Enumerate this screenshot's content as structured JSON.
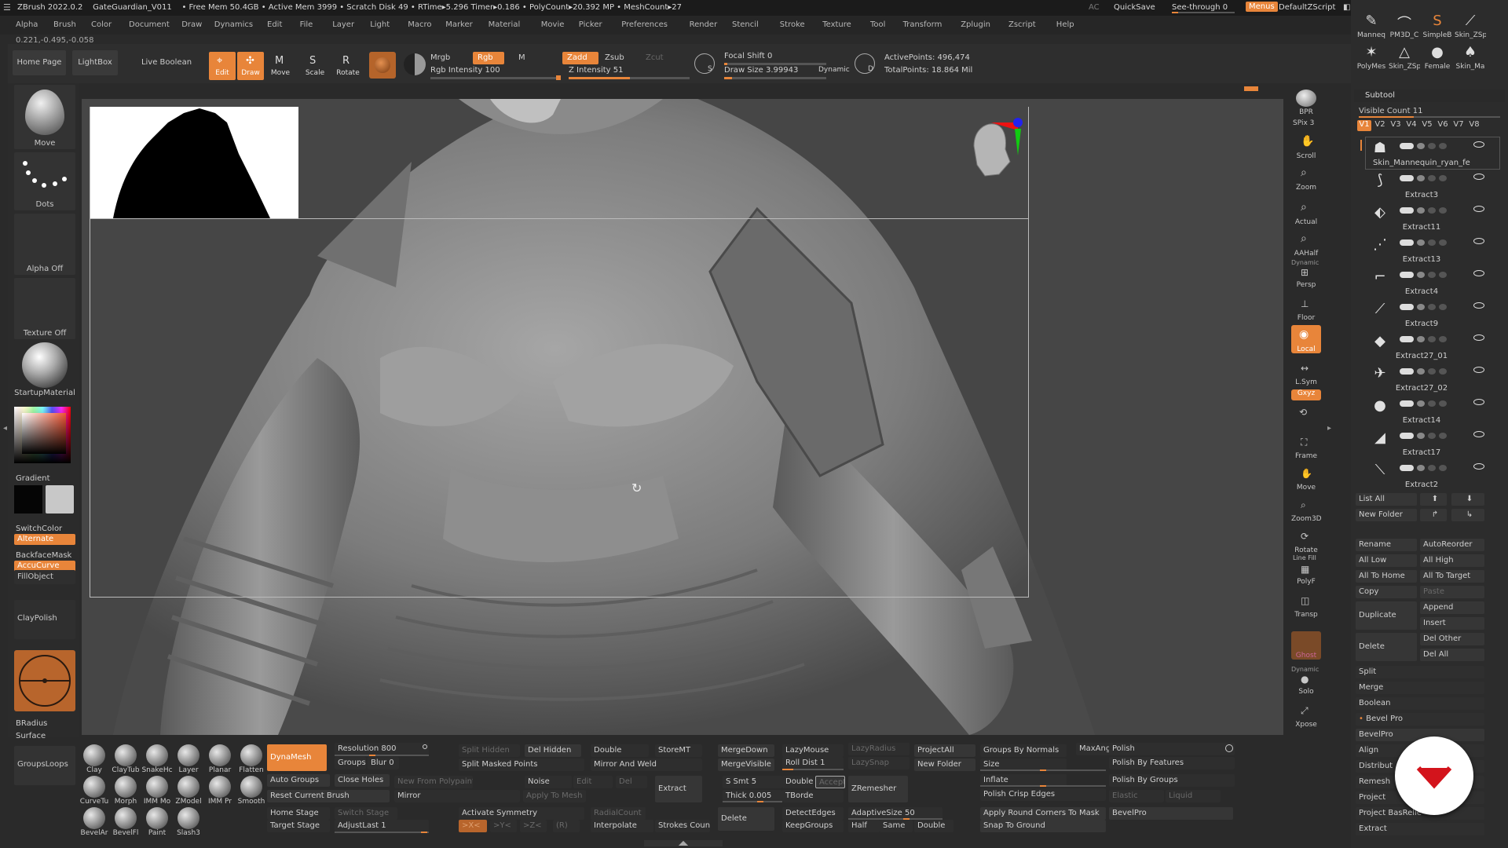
{
  "titlebar": {
    "app": "ZBrush 2022.0.2",
    "project": "GateGuardian_V011",
    "stats": "• Free Mem 50.4GB • Active Mem 3999 • Scratch Disk 49 • RTime▸5.296 Timer▸0.186 • PolyCount▸20.392 MP • MeshCount▸27",
    "ac": "AC",
    "quicksave": "QuickSave",
    "seethrough": "See-through  0",
    "menus": "Menus",
    "defaultzscript": "DefaultZScript"
  },
  "menubar": [
    "Alpha",
    "Brush",
    "Color",
    "Document",
    "Draw",
    "Dynamics",
    "Edit",
    "File",
    "Layer",
    "Light",
    "Macro",
    "Marker",
    "Material",
    "Movie",
    "Picker",
    "Preferences",
    "Render",
    "Stencil",
    "Stroke",
    "Texture",
    "Tool",
    "Transform",
    "Zplugin",
    "Zscript",
    "Help"
  ],
  "coord": "0.221,-0.495,-0.058",
  "toolbar": {
    "home": "Home Page",
    "lightbox": "LightBox",
    "liveboolean": "Live Boolean",
    "edit": "Edit",
    "draw": "Draw",
    "move": "Move",
    "scale": "Scale",
    "rotate": "Rotate",
    "mrgb": "Mrgb",
    "rgb": "Rgb",
    "m": "M",
    "rgb_intensity": "Rgb Intensity 100",
    "zadd": "Zadd",
    "zsub": "Zsub",
    "zcut": "Zcut",
    "z_intensity": "Z Intensity 51",
    "focal": "Focal Shift 0",
    "drawsize": "Draw Size 3.99943",
    "dynamic": "Dynamic",
    "active": "ActivePoints: 496,474",
    "total": "TotalPoints: 18.864 Mil"
  },
  "left": {
    "move": "Move",
    "dots": "Dots",
    "alpha": "Alpha Off",
    "texture": "Texture Off",
    "material": "StartupMaterial",
    "gradient": "Gradient",
    "switchcolor": "SwitchColor",
    "alternate": "Alternate",
    "backface": "BackfaceMask",
    "accucurve": "AccuCurve",
    "fillobject": "FillObject",
    "claypolish": "ClayPolish",
    "bradius": "BRadius",
    "surface": "Surface",
    "groupsloops": "GroupsLoops"
  },
  "shelf": {
    "bpr": "BPR",
    "spix": "SPix 3",
    "scroll": "Scroll",
    "zoom": "Zoom",
    "actual": "Actual",
    "aahalf": "AAHalf",
    "dynamic": "Dynamic",
    "persp": "Persp",
    "floor": "Floor",
    "local": "Local",
    "lsym": "L.Sym",
    "xyz": "Gxyz",
    "frame": "Frame",
    "move": "Move",
    "zoom3d": "Zoom3D",
    "rotate": "Rotate",
    "linefill": "Line Fill",
    "polyf": "PolyF",
    "transp": "Transp",
    "ghost": "Ghost",
    "dynamic2": "Dynamic",
    "solo": "Solo",
    "xpose": "Xpose"
  },
  "right": {
    "tools": [
      "Manneq",
      "PM3D_C",
      "SimpleB",
      "Skin_ZSp",
      "PolyMes",
      "Skin_ZSp",
      "Female",
      "Skin_Ma"
    ],
    "tool_counts": [
      "5",
      "",
      "",
      "29"
    ],
    "subtool": "Subtool",
    "visible": "Visible Count 11",
    "vtabs": [
      "V1",
      "V2",
      "V3",
      "V4",
      "V5",
      "V6",
      "V7",
      "V8"
    ],
    "subtools": [
      "Skin_Mannequin_ryan_female_",
      "Extract3",
      "Extract11",
      "Extract13",
      "Extract4",
      "Extract9",
      "Extract27_01",
      "Extract27_02",
      "Extract14",
      "Extract17",
      "Extract2"
    ],
    "listall": "List All",
    "newfolder": "New Folder",
    "rename": "Rename",
    "autoreorder": "AutoReorder",
    "alllow": "All Low",
    "allhigh": "All High",
    "alltohome": "All To Home",
    "alltotarget": "All To Target",
    "copy": "Copy",
    "paste": "Paste",
    "duplicate": "Duplicate",
    "append": "Append",
    "insert": "Insert",
    "delete": "Delete",
    "delother": "Del Other",
    "delall": "Del All",
    "split": "Split",
    "merge": "Merge",
    "boolean": "Boolean",
    "bevelpro": "Bevel Pro",
    "bevelpro2": "BevelPro",
    "align": "Align",
    "distribute": "Distribut",
    "remesh": "Remesh",
    "project": "Project",
    "projectbas": "Project BasRelie",
    "extract": "Extract"
  },
  "bottom": {
    "brushes": [
      "Clay",
      "ClayTub",
      "SnakeHc",
      "Layer",
      "Planar",
      "Flatten",
      "CurveTu",
      "Morph",
      "IMM Mo",
      "ZModel",
      "IMM Pr",
      "Smooth",
      "BevelAr",
      "BevelFl",
      "Paint",
      "Slash3"
    ],
    "dynamesh": "DynaMesh",
    "resolution": "Resolution 800",
    "groups": "Groups",
    "blur": "Blur 0",
    "closeholes": "Close Holes",
    "autogroups": "Auto Groups",
    "resetbrush": "Reset Current Brush",
    "splithidden": "Split Hidden",
    "splitmasked": "Split Masked Points",
    "newfrompoly": "New From Polypaint",
    "applytomesh": "Apply To Mesh",
    "mirror": "Mirror",
    "delhidden": "Del Hidden",
    "double": "Double",
    "mirrorweld": "Mirror And Weld",
    "noise": "Noise",
    "edit": "Edit",
    "del": "Del",
    "extract": "Extract",
    "storemt": "StoreMT",
    "homestage": "Home Stage",
    "targetstage": "Target Stage",
    "switchstage": "Switch Stage",
    "adjustlast": "AdjustLast 1",
    "activatesym": "Activate Symmetry",
    "xbtn": ">X<",
    "ybtn": ">Y<",
    "zbtn": ">Z<",
    "rbtn": "(R)",
    "radialcount": "RadialCount",
    "interpolate": "Interpolate",
    "strokescount": "Strokes Count",
    "delete": "Delete",
    "mergedown": "MergeDown",
    "mergevisible": "MergeVisible",
    "ssmt": "S Smt 5",
    "thick": "Thick 0.005",
    "lazymouse": "LazyMouse",
    "rolldist": "Roll Dist 1",
    "double2": "Double",
    "accept": "Accept",
    "tborde": "TBorde",
    "detectedges": "DetectEdges",
    "keepgroups": "KeepGroups",
    "lazyradius": "LazyRadius",
    "lazysnap": "LazySnap",
    "zremesher": "ZRemesher",
    "adaptivesize": "AdaptiveSize 50",
    "half": "Half",
    "same": "Same",
    "double3": "Double",
    "projectall": "ProjectAll",
    "newfolder": "New Folder",
    "groupsbynormals": "Groups By Normals",
    "size": "Size",
    "inflate": "Inflate",
    "polishcrisp": "Polish Crisp Edges",
    "applyround": "Apply Round Corners To Mask",
    "snapground": "Snap To Ground",
    "maxang": "MaxAng",
    "polish": "Polish",
    "polishfeatures": "Polish By Features",
    "polishgroups": "Polish By Groups",
    "elastic": "Elastic",
    "liquid": "Liquid",
    "bevelpro": "BevelPro"
  }
}
